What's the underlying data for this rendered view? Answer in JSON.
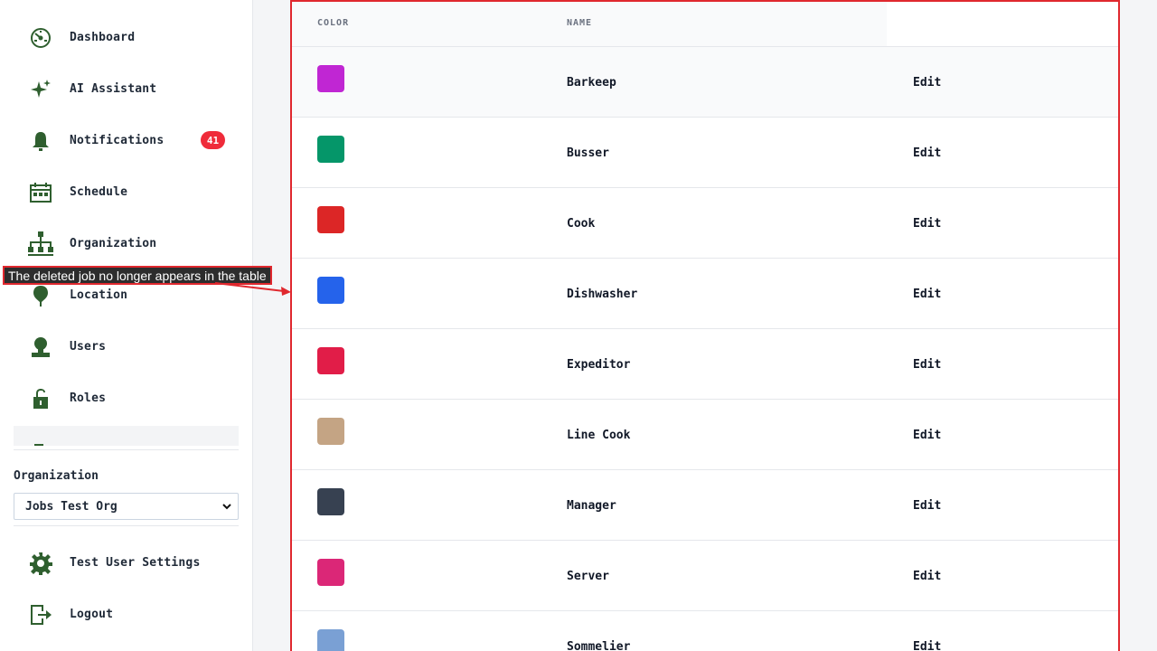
{
  "sidebar": {
    "items": [
      {
        "label": "Dashboard",
        "icon": "dashboard-icon"
      },
      {
        "label": "AI Assistant",
        "icon": "sparkle-icon"
      },
      {
        "label": "Notifications",
        "icon": "bell-icon",
        "badge": "41"
      },
      {
        "label": "Schedule",
        "icon": "calendar-icon"
      },
      {
        "label": "Organization",
        "icon": "org-chart-icon"
      },
      {
        "label": "Location",
        "icon": "map-pin-icon"
      },
      {
        "label": "Users",
        "icon": "user-icon"
      },
      {
        "label": "Roles",
        "icon": "unlock-icon"
      }
    ],
    "partial_item_icon": "briefcase-icon",
    "organization": {
      "label": "Organization",
      "selected": "Jobs Test Org"
    },
    "bottom_items": [
      {
        "label": "Test User Settings",
        "icon": "gear-icon"
      },
      {
        "label": "Logout",
        "icon": "logout-icon"
      }
    ]
  },
  "table": {
    "headers": {
      "color": "COLOR",
      "name": "NAME"
    },
    "rows": [
      {
        "name": "Barkeep",
        "color": "#c026d3",
        "action": "Edit"
      },
      {
        "name": "Busser",
        "color": "#059669",
        "action": "Edit"
      },
      {
        "name": "Cook",
        "color": "#dc2626",
        "action": "Edit"
      },
      {
        "name": "Dishwasher",
        "color": "#2563eb",
        "action": "Edit"
      },
      {
        "name": "Expeditor",
        "color": "#e11d48",
        "action": "Edit"
      },
      {
        "name": "Line Cook",
        "color": "#c4a484",
        "action": "Edit"
      },
      {
        "name": "Manager",
        "color": "#374151",
        "action": "Edit"
      },
      {
        "name": "Server",
        "color": "#db2777",
        "action": "Edit"
      },
      {
        "name": "Sommelier",
        "color": "#7aa0d4",
        "action": "Edit"
      }
    ]
  },
  "annotation": {
    "text": "The deleted job no longer appears in the table",
    "color": "#e0282e"
  },
  "colors": {
    "icon": "#2f5f2f",
    "badge": "#ef2b3a",
    "highlight": "#e0282e"
  }
}
